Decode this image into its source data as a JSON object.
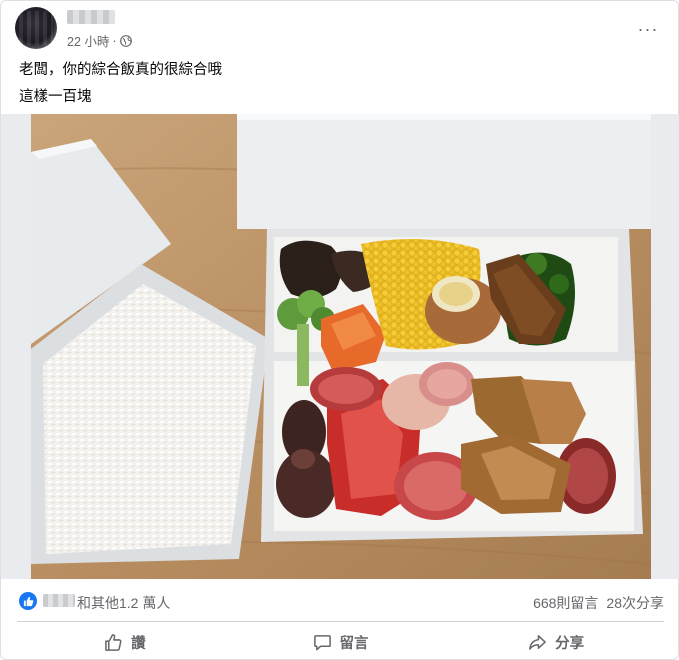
{
  "post": {
    "author_name": "",
    "time_label": "22 小時",
    "separator": "·",
    "more_label": "···",
    "text_lines": [
      "老闆，你的綜合飯真的很綜合哦",
      "這樣一百塊"
    ]
  },
  "photo": {
    "box_print": "..."
  },
  "reactions": {
    "summary": "和其他1.2 萬人",
    "comments": "668則留言",
    "shares": "28次分享"
  },
  "actions": {
    "like": "讚",
    "comment": "留言",
    "share": "分享"
  },
  "colors": {
    "accent": "#1877f2",
    "secondary_text": "#65676b"
  },
  "icons": [
    "globe-icon",
    "more-icon",
    "like-icon",
    "comment-icon",
    "share-icon"
  ]
}
